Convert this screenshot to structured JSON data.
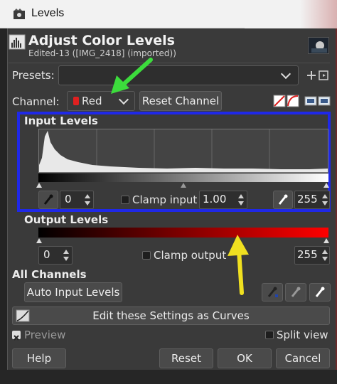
{
  "window": {
    "title": "Levels"
  },
  "header": {
    "title": "Adjust Color Levels",
    "subtitle": "Edited-13 ([IMG_2418] (imported))"
  },
  "presets": {
    "label": "Presets:",
    "value": ""
  },
  "channel": {
    "label": "Channel:",
    "value": "Red",
    "swatch_color": "#e02020",
    "reset_label": "Reset Channel"
  },
  "input_levels": {
    "title": "Input Levels",
    "low": "0",
    "clamp_label": "Clamp input",
    "gamma": "1.00",
    "high": "255"
  },
  "output_levels": {
    "title": "Output Levels",
    "low": "0",
    "clamp_label": "Clamp output",
    "high": "255"
  },
  "all_channels": {
    "title": "All Channels",
    "auto_label": "Auto Input Levels"
  },
  "curves_label": "Edit these Settings as Curves",
  "preview_label": "Preview",
  "split_view_label": "Split view",
  "buttons": {
    "help": "Help",
    "reset": "Reset",
    "ok": "OK",
    "cancel": "Cancel"
  },
  "annotation_colors": {
    "green_arrow": "#3cdc3c",
    "yellow_arrow": "#f0e020",
    "blue_box": "#1f28e8"
  }
}
